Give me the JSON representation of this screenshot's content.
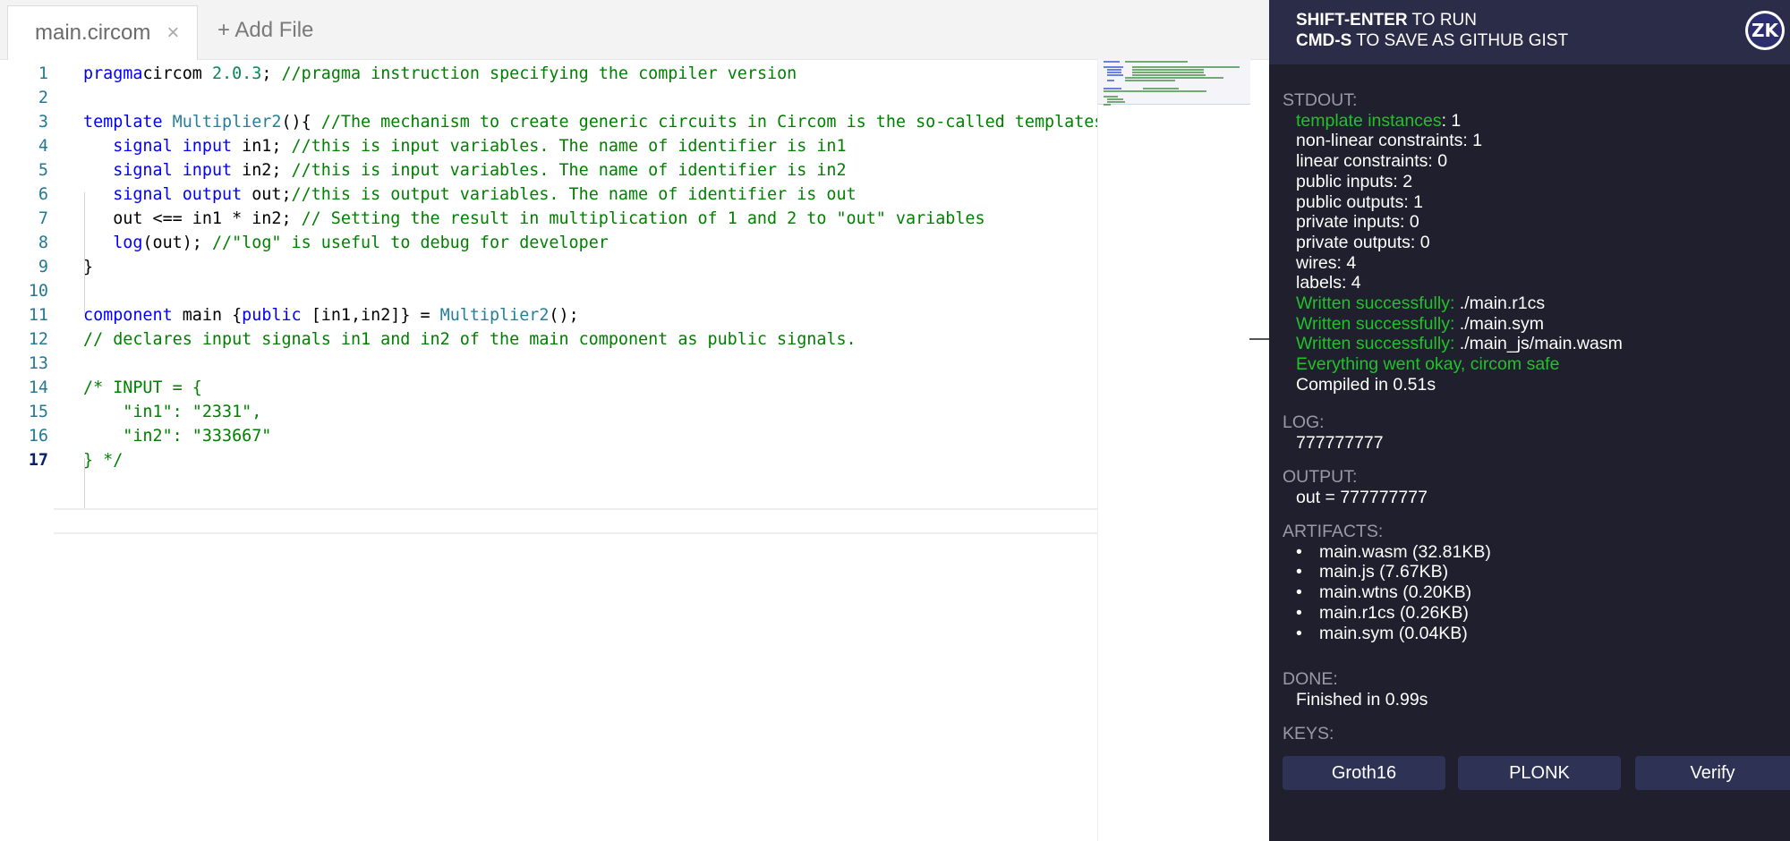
{
  "tabs": {
    "active_tab": "main.circom",
    "close_glyph": "×",
    "add_file": "+ Add File"
  },
  "editor": {
    "active_line": 17,
    "lines": [
      {
        "n": "1",
        "parts": [
          [
            "kw",
            "pragma"
          ],
          [
            "",
            "circom "
          ],
          [
            "num",
            "2.0.3"
          ],
          [
            "",
            "; "
          ],
          [
            "cm",
            "//pragma instruction specifying the compiler version"
          ]
        ]
      },
      {
        "n": "2",
        "parts": []
      },
      {
        "n": "3",
        "parts": [
          [
            "kw",
            "template "
          ],
          [
            "ty",
            "Multiplier2"
          ],
          [
            "",
            "(){ "
          ],
          [
            "cm",
            "//The mechanism to create generic circuits in Circom is the so-called templates"
          ]
        ]
      },
      {
        "n": "4",
        "parts": [
          [
            "",
            "   "
          ],
          [
            "kw",
            "signal input "
          ],
          [
            "",
            "in1; "
          ],
          [
            "cm",
            "//this is input variables. The name of identifier is in1"
          ]
        ]
      },
      {
        "n": "5",
        "parts": [
          [
            "",
            "   "
          ],
          [
            "kw",
            "signal input "
          ],
          [
            "",
            "in2; "
          ],
          [
            "cm",
            "//this is input variables. The name of identifier is in2"
          ]
        ]
      },
      {
        "n": "6",
        "parts": [
          [
            "",
            "   "
          ],
          [
            "kw",
            "signal output "
          ],
          [
            "",
            "out;"
          ],
          [
            "cm",
            "//this is output variables. The name of identifier is out"
          ]
        ]
      },
      {
        "n": "7",
        "parts": [
          [
            "",
            "   out <== in1 * in2; "
          ],
          [
            "cm",
            "// Setting the result in multiplication of 1 and 2 to \"out\" variables"
          ]
        ]
      },
      {
        "n": "8",
        "parts": [
          [
            "",
            "   "
          ],
          [
            "kw",
            "log"
          ],
          [
            "",
            "(out); "
          ],
          [
            "cm",
            "//\"log\" is useful to debug for developer"
          ]
        ]
      },
      {
        "n": "9",
        "parts": [
          [
            "",
            "}"
          ]
        ]
      },
      {
        "n": "10",
        "parts": []
      },
      {
        "n": "11",
        "parts": [
          [
            "kw",
            "component "
          ],
          [
            "",
            "main {"
          ],
          [
            "kw",
            "public "
          ],
          [
            "",
            "[in1,in2]} = "
          ],
          [
            "ty",
            "Multiplier2"
          ],
          [
            "",
            "();"
          ]
        ]
      },
      {
        "n": "12",
        "parts": [
          [
            "cm",
            "// declares input signals in1 and in2 of the main component as public signals."
          ]
        ]
      },
      {
        "n": "13",
        "parts": []
      },
      {
        "n": "14",
        "parts": [
          [
            "cm",
            "/* INPUT = {"
          ]
        ]
      },
      {
        "n": "15",
        "parts": [
          [
            "cm",
            "    \"in1\": \"2331\","
          ]
        ]
      },
      {
        "n": "16",
        "parts": [
          [
            "cm",
            "    \"in2\": \"333667\""
          ]
        ]
      },
      {
        "n": "17",
        "parts": [
          [
            "cm",
            "} */"
          ]
        ]
      }
    ]
  },
  "panel": {
    "hint_run_bold": "SHIFT-ENTER",
    "hint_run": " TO RUN",
    "hint_save_bold": "CMD-S",
    "hint_save": " TO SAVE AS GITHUB GIST",
    "logo_text": "ZK",
    "stdout_label": "STDOUT:",
    "stdout": {
      "template_key": "template instances",
      "template_val": ": 1",
      "nonlinear": "non-linear constraints: 1",
      "linear": "linear constraints: 0",
      "public_inputs": "public inputs: 2",
      "public_outputs": "public outputs: 1",
      "private_inputs": "private inputs: 0",
      "private_outputs": "private outputs: 0",
      "wires": "wires: 4",
      "labels": "labels: 4",
      "written_label": "Written successfully:",
      "written_1": " ./main.r1cs",
      "written_2": " ./main.sym",
      "written_3": " ./main_js/main.wasm",
      "everything_ok": "Everything went okay, circom safe",
      "compiled": "Compiled in 0.51s"
    },
    "log_label": "LOG:",
    "log_value": "777777777",
    "output_label": "OUTPUT:",
    "output_value": "out = 777777777",
    "artifacts_label": "ARTIFACTS:",
    "artifacts": [
      "main.wasm (32.81KB)",
      "main.js (7.67KB)",
      "main.wtns (0.20KB)",
      "main.r1cs (0.26KB)",
      "main.sym (0.04KB)"
    ],
    "bullet": "•",
    "done_label": "DONE:",
    "done_value": "Finished in 0.99s",
    "keys_label": "KEYS:",
    "buttons": {
      "groth16": "Groth16",
      "plonk": "PLONK",
      "verify": "Verify"
    }
  },
  "colors": {
    "panel_bg": "#1f1f2e",
    "panel_header": "#2b2c48",
    "success_green": "#22c229",
    "keyword_blue": "#0000ff",
    "comment_green": "#008000",
    "type_teal": "#267f99"
  }
}
